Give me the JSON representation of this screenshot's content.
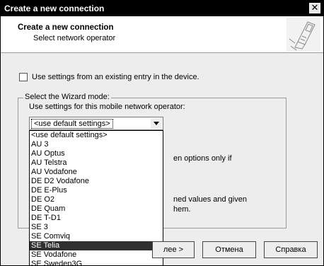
{
  "window": {
    "title": "Create a new connection",
    "close_glyph": "✕"
  },
  "header": {
    "title": "Create a new connection",
    "subtitle": "Select network operator",
    "art_icon": "phone-icon"
  },
  "checkbox": {
    "label": "Use settings from an existing entry in the device.",
    "checked": false
  },
  "wizard_group": {
    "legend": "Select the Wizard mode:",
    "operator_label": "Use settings for this mobile network operator:"
  },
  "combo": {
    "value": "<use default settings>"
  },
  "dropdown": {
    "items": [
      "<use default settings>",
      "AU  3",
      "AU  Optus",
      "AU  Telstra",
      "AU  Vodafone",
      "DE  D2 Vodafone",
      "DE  E-Plus",
      "DE  O2",
      "DE  Quam",
      "DE  T-D1",
      "SE  3",
      "SE  Comviq",
      "SE  Telia",
      "SE  Vodafone",
      "SE  Sweden3G"
    ],
    "selected_index": 12
  },
  "hidden_text": {
    "line1": "en options only if",
    "line2": "ned values and given",
    "line3": "hem."
  },
  "buttons": {
    "next": "лее >",
    "cancel": "Отмена",
    "help": "Справка"
  }
}
